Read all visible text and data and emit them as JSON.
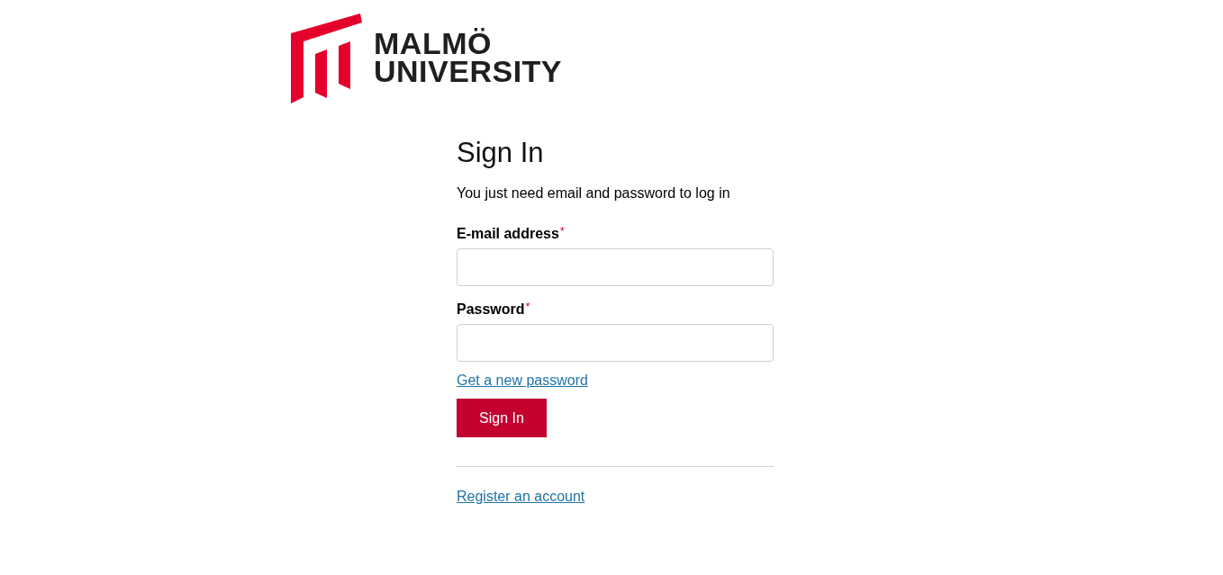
{
  "logo": {
    "lines": [
      "MALMÖ",
      "UNIVERSITY"
    ]
  },
  "heading": "Sign In",
  "intro": "You just need email and password to log in",
  "fields": [
    {
      "label": "E-mail address",
      "required": true,
      "required_mark": "*"
    },
    {
      "label": "Password",
      "required": true,
      "required_mark": "*"
    }
  ],
  "forgot_link": "Get a new password",
  "submit": "Sign In",
  "register_link": "Register an account"
}
